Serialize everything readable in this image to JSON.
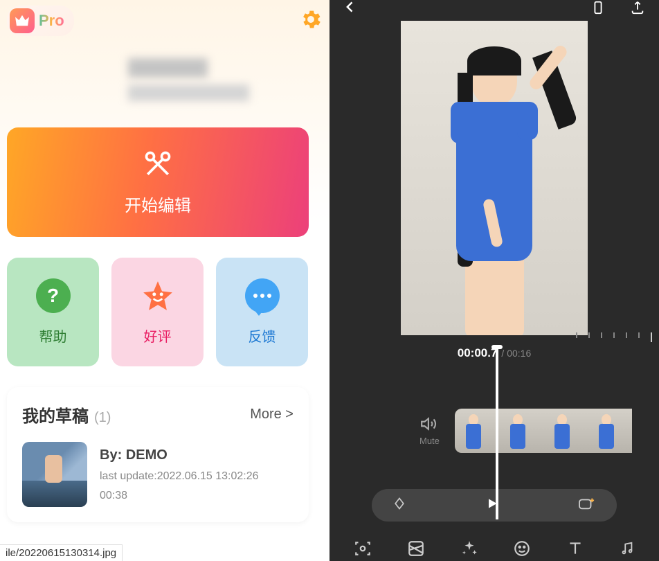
{
  "header": {
    "pro_label": "Pro"
  },
  "start_edit": {
    "label": "开始编辑"
  },
  "actions": {
    "help": {
      "label": "帮助",
      "icon": "?"
    },
    "rate": {
      "label": "好评"
    },
    "feedback": {
      "label": "反馈"
    }
  },
  "drafts": {
    "title": "我的草稿",
    "count": "(1)",
    "more_label": "More >",
    "items": [
      {
        "by": "By: DEMO",
        "last_update": "last update:2022.06.15 13:02:26",
        "duration": "00:38"
      }
    ]
  },
  "filepath": "ile/20220615130314.jpg",
  "editor": {
    "time_current": "00:00.7",
    "time_total": "/ 00:16",
    "mute_label": "Mute"
  },
  "icons": {
    "crown": "crown",
    "gear": "settings",
    "scissors": "scissors",
    "back": "back",
    "aspect": "aspect-ratio",
    "export": "export",
    "speaker": "speaker",
    "keyframe": "keyframe",
    "play": "play",
    "addclip": "add-clip",
    "scan": "scan",
    "pattern": "pattern",
    "sparkle": "sparkle",
    "emoji": "emoji",
    "text": "text",
    "music": "music"
  }
}
